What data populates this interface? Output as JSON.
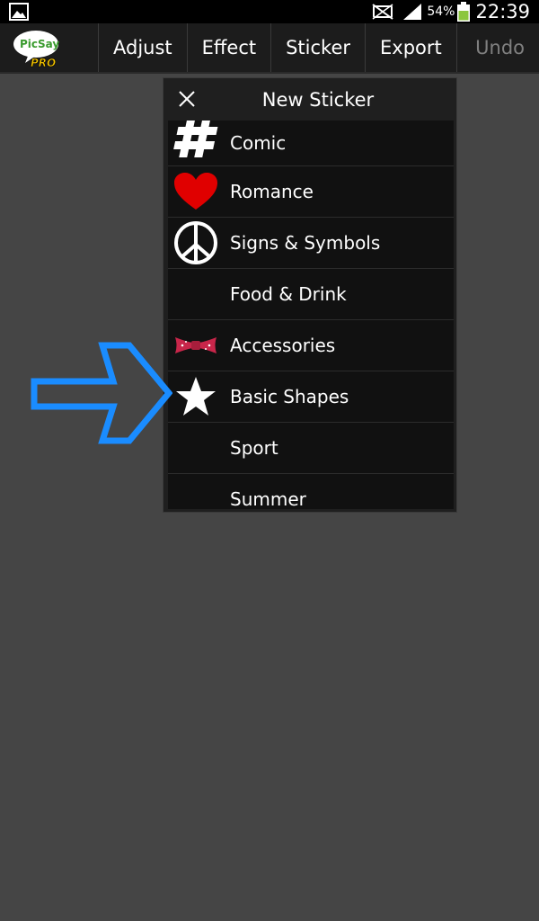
{
  "status_bar": {
    "battery_percent": "54%",
    "time": "22:39",
    "icons": [
      "gallery-icon",
      "mute-icon",
      "signal-icon",
      "battery-icon"
    ]
  },
  "action_bar": {
    "logo_text": "PicSay",
    "logo_sub": "PRO",
    "menu": [
      {
        "label": "Adjust"
      },
      {
        "label": "Effect"
      },
      {
        "label": "Sticker"
      },
      {
        "label": "Export"
      }
    ],
    "undo_label": "Undo"
  },
  "dialog": {
    "title": "New Sticker",
    "close_icon": "close-icon",
    "items": [
      {
        "label": "Comic",
        "icon": "hashtag-icon"
      },
      {
        "label": "Romance",
        "icon": "heart-icon"
      },
      {
        "label": "Signs & Symbols",
        "icon": "peace-icon"
      },
      {
        "label": "Food & Drink",
        "icon": ""
      },
      {
        "label": "Accessories",
        "icon": "bowtie-icon"
      },
      {
        "label": "Basic Shapes",
        "icon": "star-icon"
      },
      {
        "label": "Sport",
        "icon": ""
      },
      {
        "label": "Summer",
        "icon": ""
      }
    ]
  },
  "annotation": {
    "icon": "arrow-right-icon",
    "color": "#1a8cff"
  },
  "colors": {
    "background": "#454545",
    "status_bar": "#000000",
    "action_bar": "#1c1c1c",
    "dialog": "#1f1f1f",
    "list": "#111111",
    "undo_disabled": "#808080",
    "heart": "#e00000",
    "bowtie": "#c8264a",
    "arrow": "#1a8cff"
  }
}
